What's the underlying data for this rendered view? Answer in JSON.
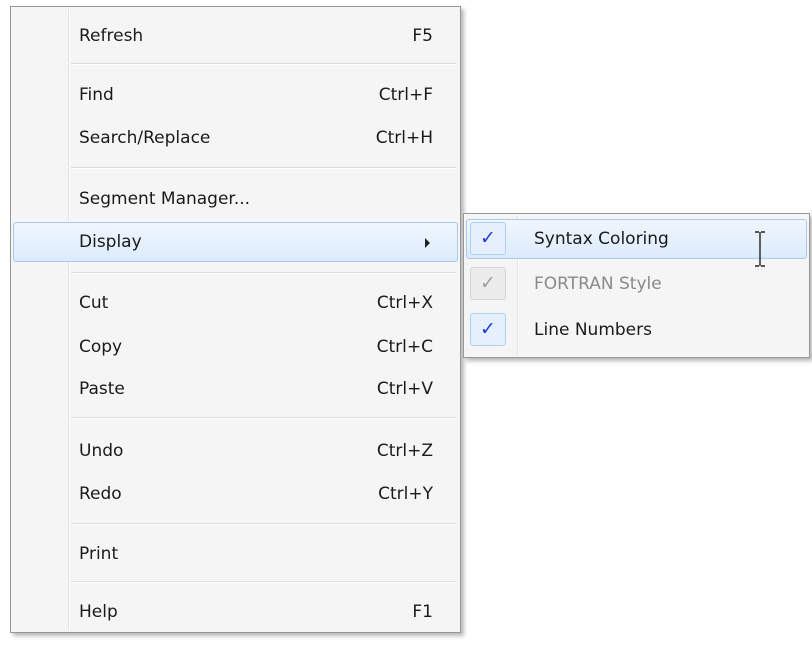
{
  "menu": {
    "items": [
      {
        "label": "Refresh",
        "shortcut": "F5"
      },
      {
        "label": "Find",
        "shortcut": "Ctrl+F"
      },
      {
        "label": "Search/Replace",
        "shortcut": "Ctrl+H"
      },
      {
        "label": "Segment Manager...",
        "shortcut": ""
      },
      {
        "label": "Display",
        "shortcut": ""
      },
      {
        "label": "Cut",
        "shortcut": "Ctrl+X"
      },
      {
        "label": "Copy",
        "shortcut": "Ctrl+C"
      },
      {
        "label": "Paste",
        "shortcut": "Ctrl+V"
      },
      {
        "label": "Undo",
        "shortcut": "Ctrl+Z"
      },
      {
        "label": "Redo",
        "shortcut": "Ctrl+Y"
      },
      {
        "label": "Print",
        "shortcut": ""
      },
      {
        "label": "Help",
        "shortcut": "F1"
      }
    ]
  },
  "submenu": {
    "items": [
      {
        "label": "Syntax Coloring",
        "checked": true,
        "enabled": true,
        "check_glyph": "✓"
      },
      {
        "label": "FORTRAN Style",
        "checked": true,
        "enabled": false,
        "check_glyph": "✓"
      },
      {
        "label": "Line Numbers",
        "checked": true,
        "enabled": true,
        "check_glyph": "✓"
      }
    ]
  },
  "icons": {
    "submenu_arrow": "chevron-right-icon",
    "checkmark": "checkmark-icon",
    "cursor": "text-cursor-icon"
  },
  "colors": {
    "highlight_border": "#a8caf0",
    "check_color": "#1c3fd1",
    "disabled_text": "#8a8a8a"
  }
}
